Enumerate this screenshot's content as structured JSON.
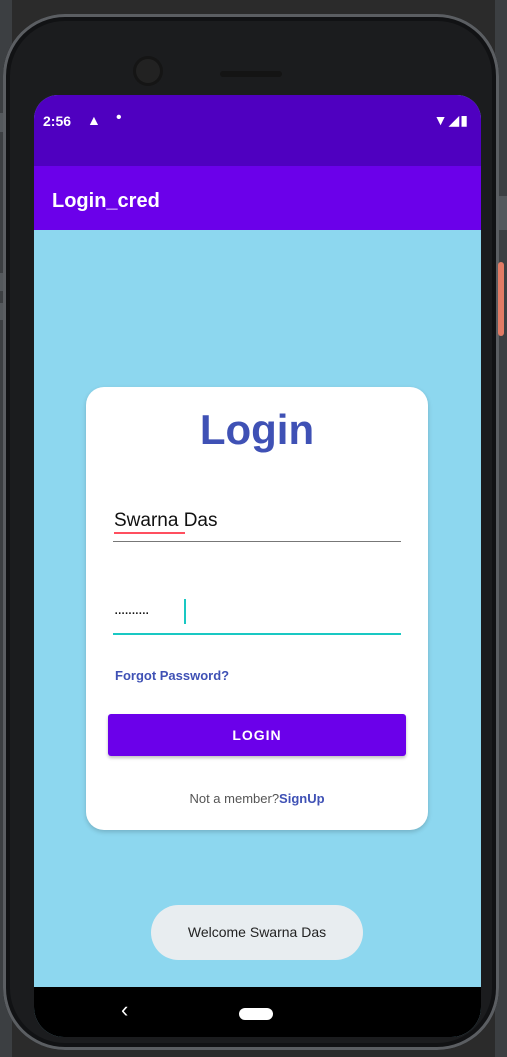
{
  "status": {
    "time": "2:56",
    "warning_icon": "warning-triangle-icon",
    "dot_icon": "notification-dot-icon",
    "signal_icons": "wifi-signal-battery-icons"
  },
  "app": {
    "title": "Login_cred"
  },
  "login": {
    "heading": "Login",
    "username_value": "Swarna Das",
    "password_mask": "..........",
    "forgot_password": "Forgot Password?",
    "button_label": "LOGIN",
    "signup_prefix": "Not a member?",
    "signup_link": "SignUp"
  },
  "toast": {
    "message": "Welcome Swarna Das"
  },
  "navigation": {
    "back_icon": "back-arrow-icon",
    "home_icon": "home-pill-icon"
  },
  "colors": {
    "status_bar": "#4f00c0",
    "app_bar": "#6b00ea",
    "background": "#8dd7ef",
    "title": "#3f51b5",
    "active_underline": "#19c8c3"
  }
}
